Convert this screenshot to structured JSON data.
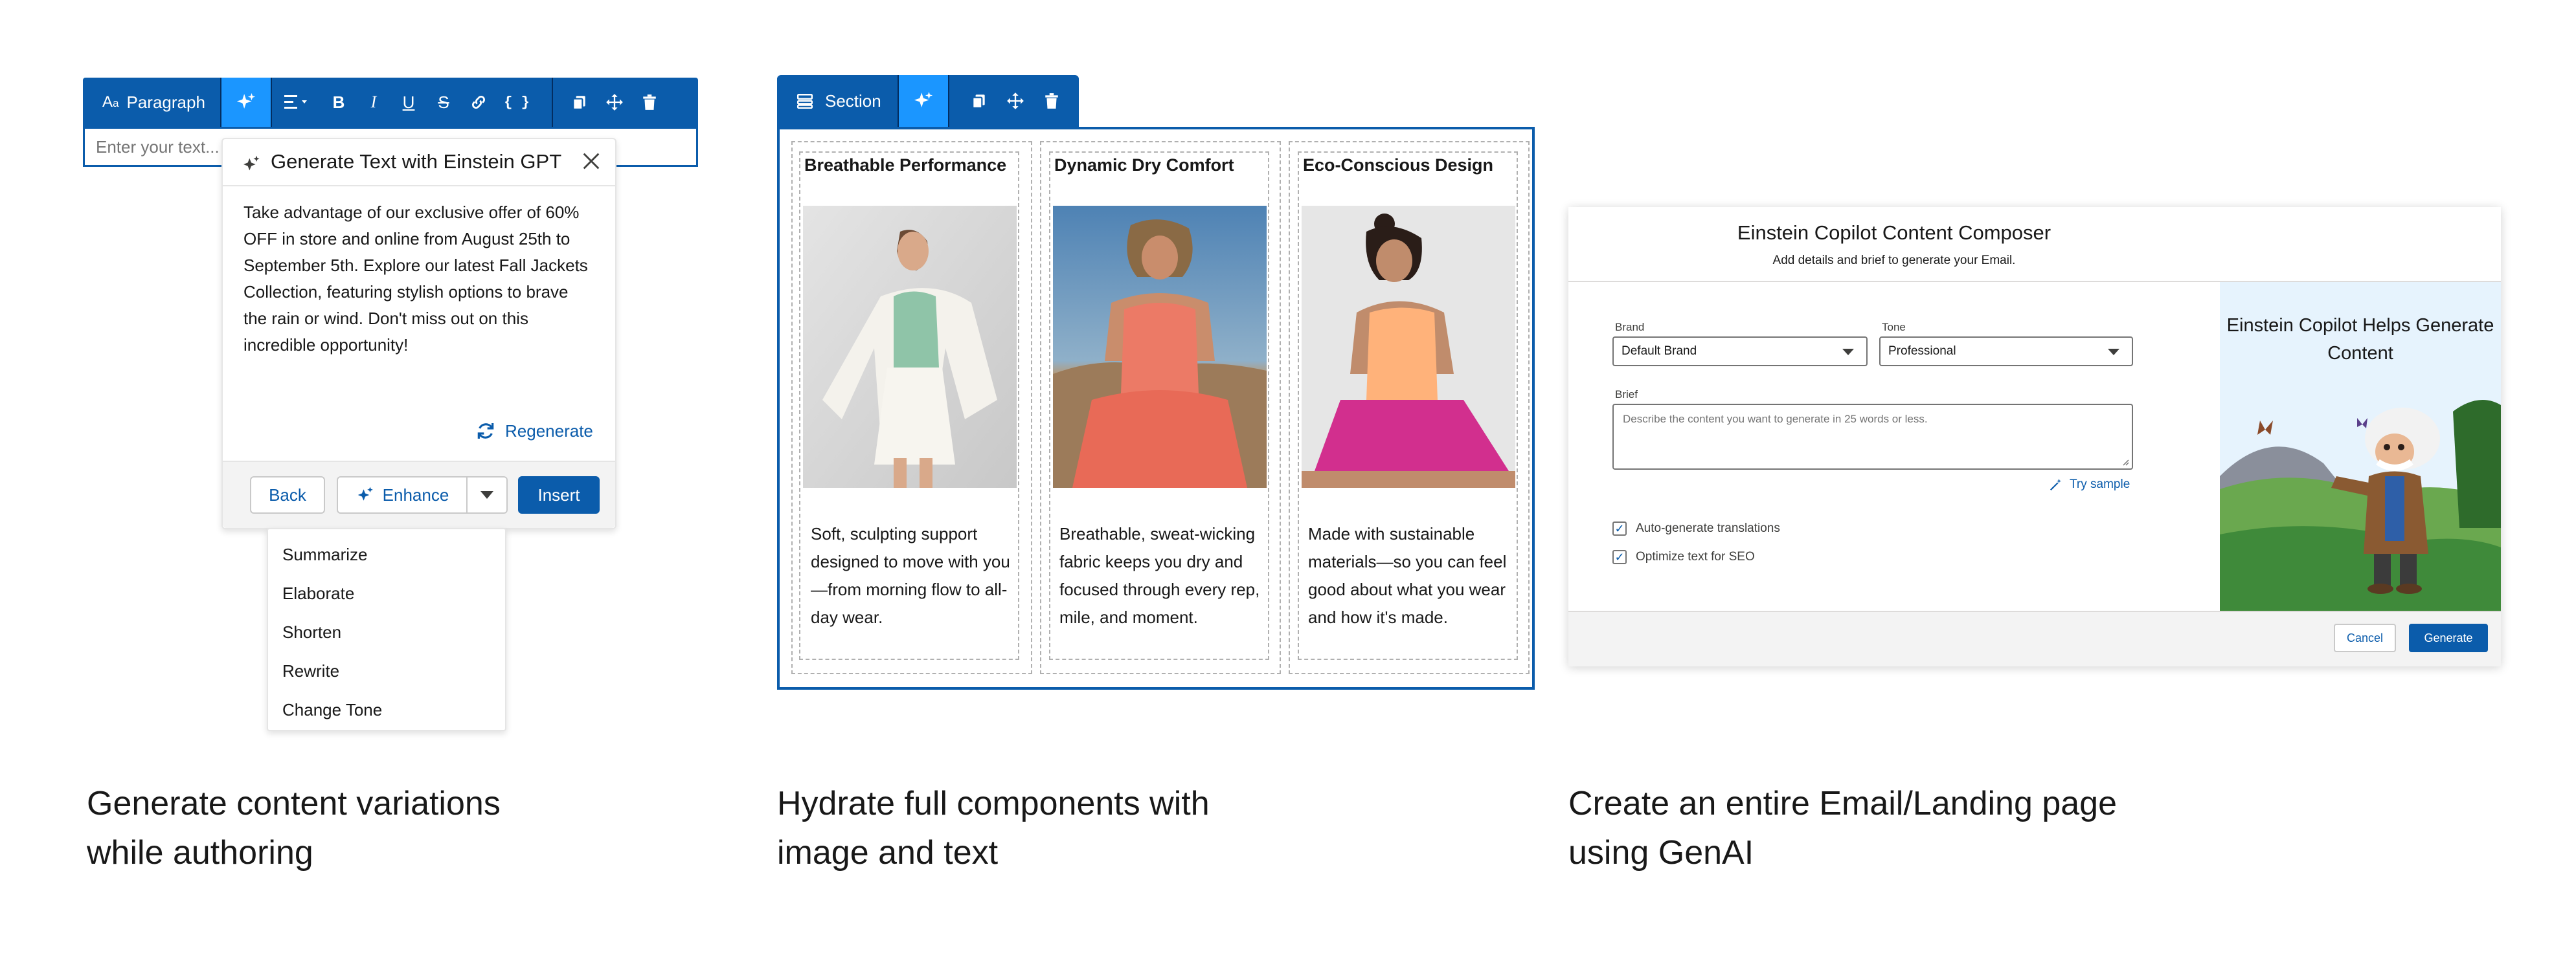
{
  "panel1": {
    "toolbar": {
      "paragraph_label": "Paragraph",
      "icons": [
        "text-style-icon",
        "sparkle-icon",
        "align-icon",
        "bold-icon",
        "italic-icon",
        "underline-icon",
        "strikethrough-icon",
        "link-icon",
        "merge-field-icon",
        "copy-icon",
        "move-icon",
        "delete-icon"
      ]
    },
    "editor_placeholder": "Enter your text...",
    "gen_card": {
      "title": "Generate Text with Einstein GPT",
      "body": "Take advantage of our exclusive offer of 60% OFF in store and online from August 25th to September 5th. Explore our latest Fall Jackets Collection, featuring stylish options to brave the rain or wind. Don't miss out on this incredible opportunity!",
      "regenerate_label": "Regenerate",
      "back_label": "Back",
      "enhance_label": "Enhance",
      "insert_label": "Insert"
    },
    "enhance_menu": [
      "Summarize",
      "Elaborate",
      "Shorten",
      "Rewrite",
      "Change Tone"
    ]
  },
  "panel2": {
    "toolbar": {
      "section_label": "Section"
    },
    "cards": [
      {
        "title": "Breathable Performance",
        "text": "Soft, sculpting support designed to move with you—from morning flow to all-day wear.",
        "image": "woman-green-top-photo"
      },
      {
        "title": "Dynamic Dry Comfort",
        "text": "Breathable, sweat-wicking fabric keeps you dry and focused through every rep, mile, and moment.",
        "image": "woman-coral-top-photo"
      },
      {
        "title": "Eco-Conscious Design",
        "text": "Made with sustainable materials—so you can feel good about what you wear and how it's made.",
        "image": "woman-orange-top-photo"
      }
    ]
  },
  "panel3": {
    "title": "Einstein Copilot Content Composer",
    "subtitle": "Add details and brief to generate your Email.",
    "brand_label": "Brand",
    "brand_value": "Default Brand",
    "tone_label": "Tone",
    "tone_value": "Professional",
    "brief_label": "Brief",
    "brief_placeholder": "Describe the content you want to generate in 25 words or less.",
    "try_sample_label": "Try sample",
    "checkboxes": [
      {
        "label": "Auto-generate translations",
        "checked": true
      },
      {
        "label": "Optimize text for SEO",
        "checked": true
      }
    ],
    "illustration_title": "Einstein Copilot Helps Generate Content",
    "cancel_label": "Cancel",
    "generate_label": "Generate"
  },
  "captions": [
    "Generate content variations while authoring",
    "Hydrate full components with image and text",
    "Create an entire Email/Landing page using GenAI"
  ],
  "colors": {
    "brand": "#0b5cab",
    "brand_active": "#1b96ff",
    "text": "#181818",
    "muted": "#747474"
  }
}
